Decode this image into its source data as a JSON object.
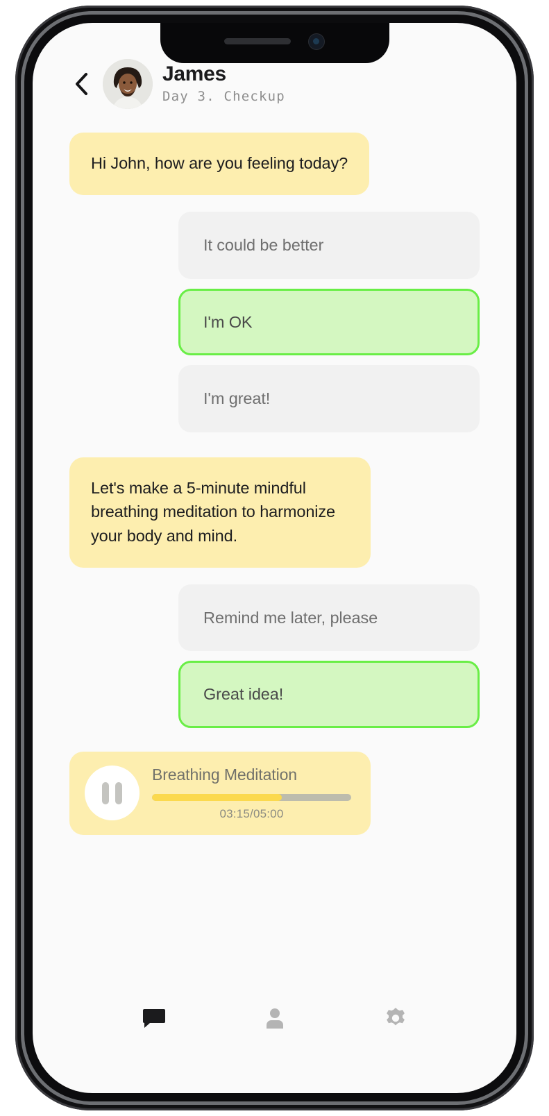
{
  "header": {
    "back_icon": "chevron-left-icon",
    "avatar_icon": "user-avatar-photo",
    "name": "James",
    "subtitle": "Day 3. Checkup"
  },
  "conversation": [
    {
      "bot_message": "Hi John, how are you feeling today?",
      "options": [
        {
          "label": "It could be better",
          "selected": false
        },
        {
          "label": "I'm OK",
          "selected": true
        },
        {
          "label": "I'm great!",
          "selected": false
        }
      ]
    },
    {
      "bot_message": "Let's make a 5-minute mindful breathing meditation to harmonize your body and mind.",
      "options": [
        {
          "label": "Remind me later, please",
          "selected": false
        },
        {
          "label": "Great idea!",
          "selected": true
        }
      ]
    }
  ],
  "player": {
    "title": "Breathing Meditation",
    "time_label": "03:15/05:00",
    "elapsed": "03:15",
    "duration": "05:00",
    "progress_percent": 65,
    "control_icon": "pause-icon",
    "state": "playing"
  },
  "nav": {
    "items": [
      {
        "name": "chat",
        "icon": "chat-bubble-icon",
        "active": true
      },
      {
        "name": "profile",
        "icon": "person-icon",
        "active": false
      },
      {
        "name": "settings",
        "icon": "gear-icon",
        "active": false
      }
    ]
  },
  "colors": {
    "bot_bubble": "#fdeeaf",
    "option_idle": "#f1f1f1",
    "option_selected_fill": "#d4f7c1",
    "option_selected_border": "#69ee46",
    "progress_fill": "#fbd94e",
    "progress_track": "#bdbcad",
    "screen_bg": "#fafafa"
  }
}
